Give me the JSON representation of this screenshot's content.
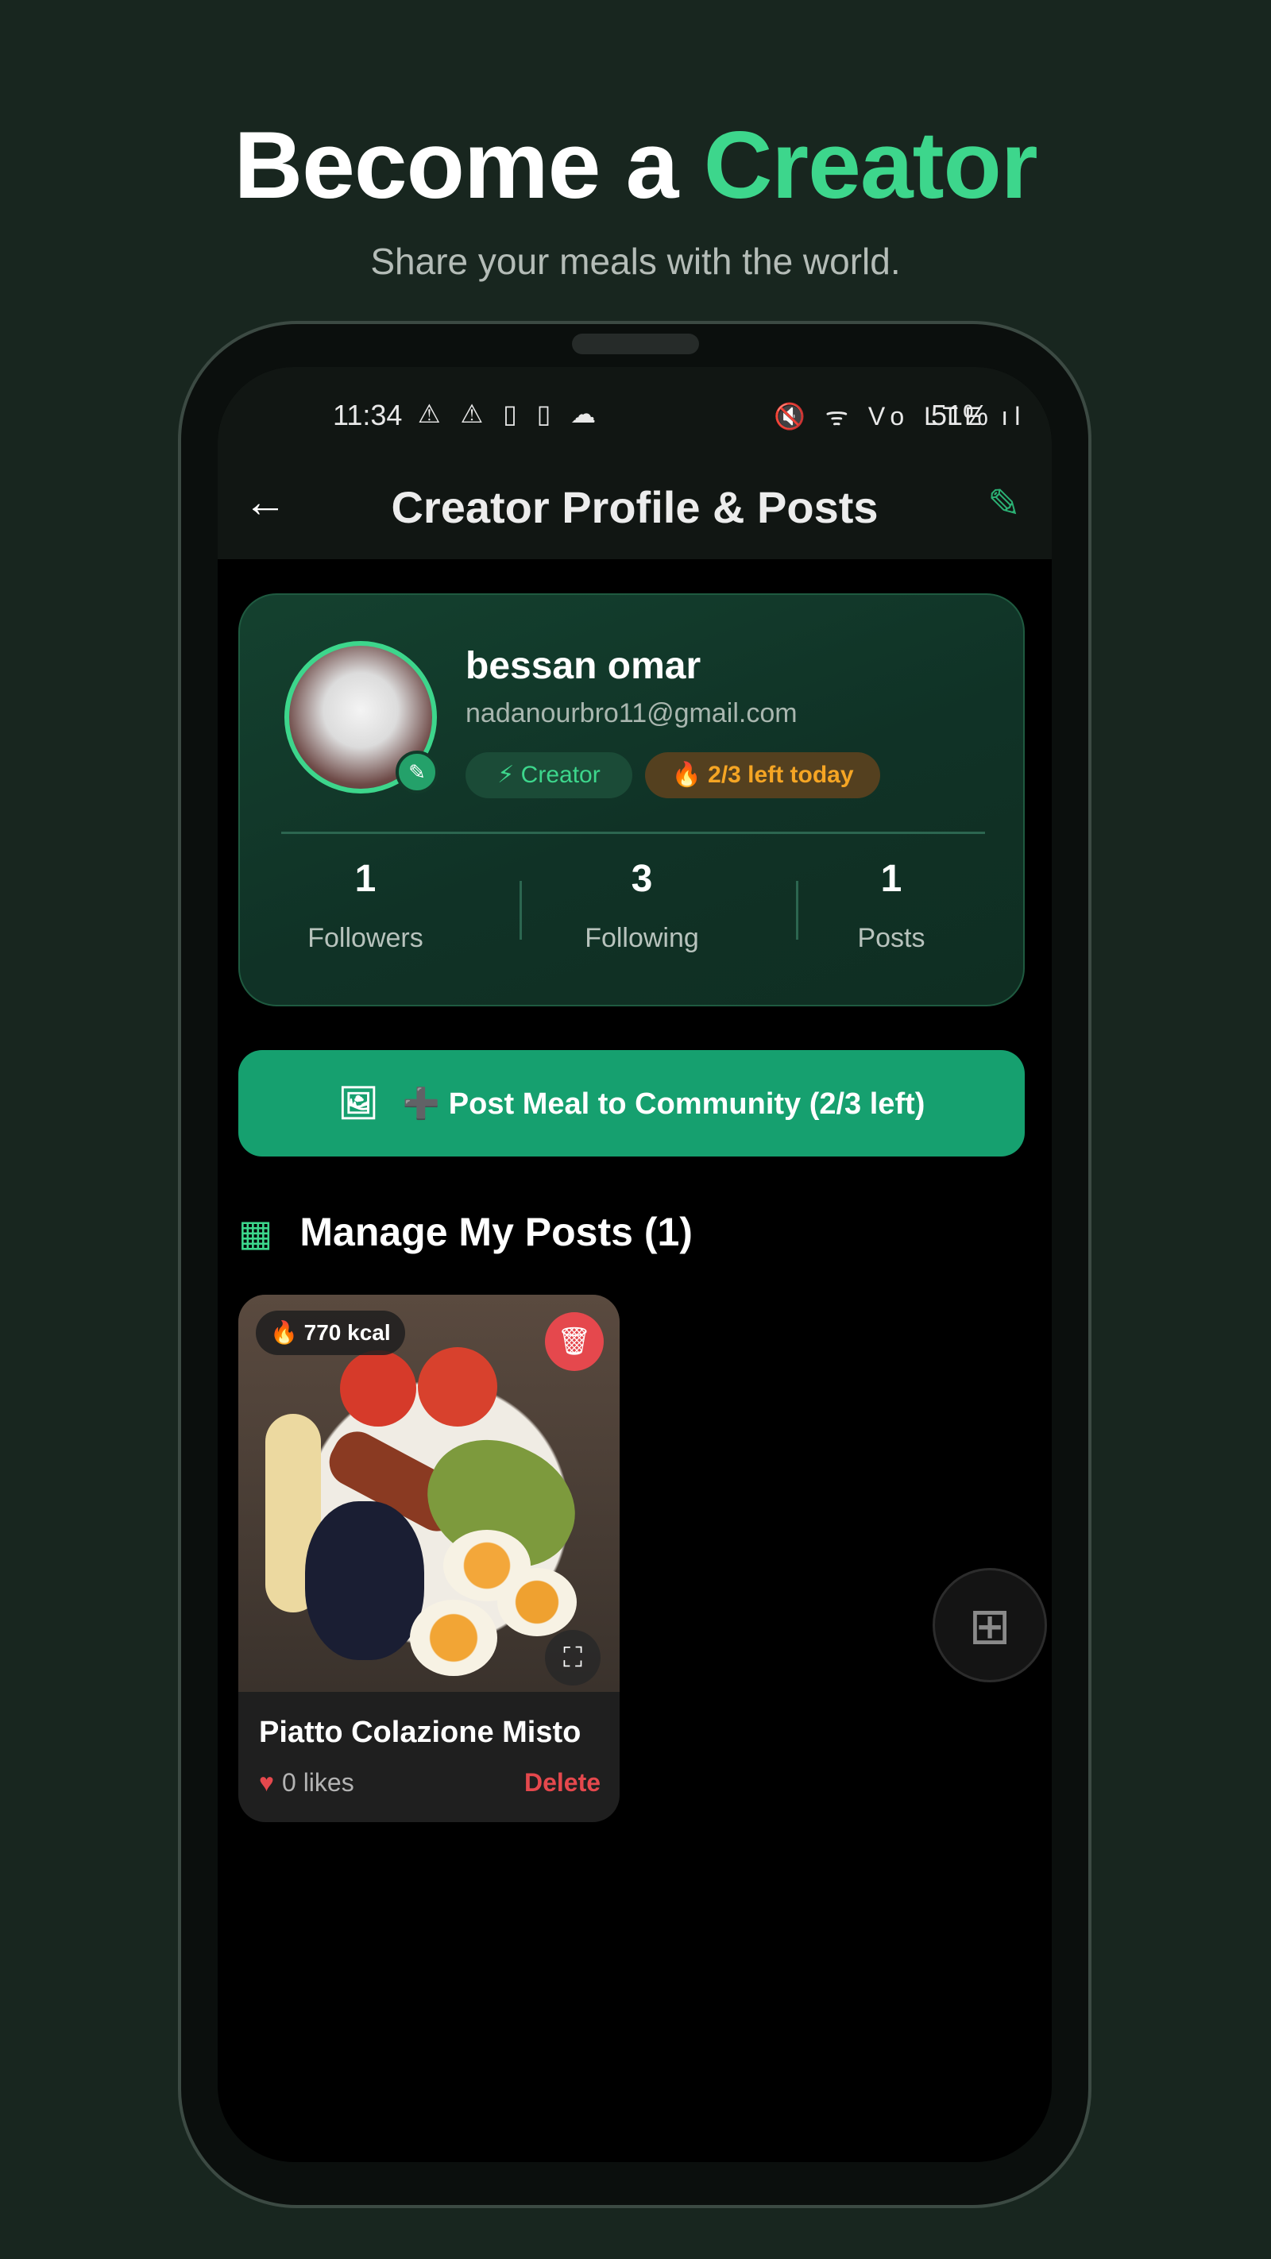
{
  "hero": {
    "title_part1": "Become a",
    "title_accent": "Creator",
    "subtitle": "Share your meals with the world."
  },
  "status_bar": {
    "time": "11:34",
    "left_icons": "⚠ ⚠ ▯ ▯ ☁",
    "right_icons": "🔇 ᯤ Vo LTE ıl",
    "battery": "51%"
  },
  "app_bar": {
    "title": "Creator Profile & Posts",
    "back_icon": "←",
    "edit_icon": "✎"
  },
  "profile": {
    "name": "bessan omar",
    "email": "nadanourbro11@gmail.com",
    "badge_creator": "⚡ Creator",
    "badge_limit": "🔥 2/3 left today",
    "stats": [
      {
        "value": "1",
        "label": "Followers"
      },
      {
        "value": "3",
        "label": "Following"
      },
      {
        "value": "1",
        "label": "Posts"
      }
    ]
  },
  "post_button": {
    "icon": "🖼",
    "label": "➕ Post Meal to Community (2/3 left)"
  },
  "section": {
    "icon": "▦",
    "title": "Manage My Posts (1)"
  },
  "posts": [
    {
      "kcal": "🔥 770 kcal",
      "title": "Piatto Colazione Misto",
      "likes": "0 likes",
      "delete_label": "Delete"
    }
  ],
  "colors": {
    "background": "#18261f",
    "accent": "#3dd68c",
    "button": "#16a06f",
    "danger": "#e5484d",
    "warning": "#f5a524"
  }
}
